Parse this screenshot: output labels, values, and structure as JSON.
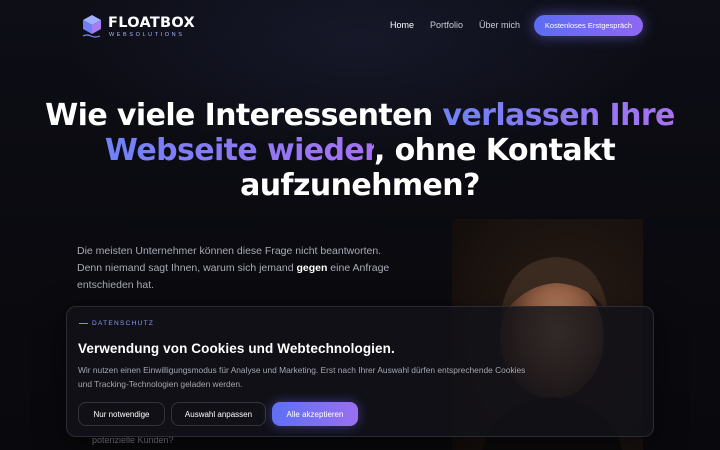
{
  "brand": {
    "name": "FLOATBOX",
    "tagline": "WEBSOLUTIONS",
    "accent_blue": "#5b6cf4",
    "accent_purple": "#9a6ff2"
  },
  "nav": {
    "items": [
      {
        "label": "Home",
        "active": true
      },
      {
        "label": "Portfolio",
        "active": false
      },
      {
        "label": "Über mich",
        "active": false
      }
    ],
    "cta_label": "Kostenloses Erstgespräch"
  },
  "hero": {
    "title_part1": "Wie viele Interessenten ",
    "title_highlight1": "verlassen Ihre",
    "title_highlight2": "Webseite wieder",
    "title_part2": ", ohne Kontakt",
    "title_part3": "aufzunehmen?",
    "text_part1": "Die meisten Unternehmer können diese Frage nicht beantworten. Denn niemand sagt Ihnen, warum sich jemand ",
    "text_bold": "gegen",
    "text_part2": " eine Anfrage entschieden hat.",
    "obscured_text": "potenzielle Kunden?"
  },
  "cookie": {
    "eyebrow": "DATENSCHUTZ",
    "title": "Verwendung von Cookies und Webtechnologien.",
    "text": "Wir nutzen einen Einwilligungsmodus für Analyse und Marketing. Erst nach Ihrer Auswahl dürfen entsprechende Cookies und Tracking-Technologien geladen werden.",
    "btn_necessary": "Nur notwendige",
    "btn_customize": "Auswahl anpassen",
    "btn_accept": "Alle akzeptieren"
  }
}
